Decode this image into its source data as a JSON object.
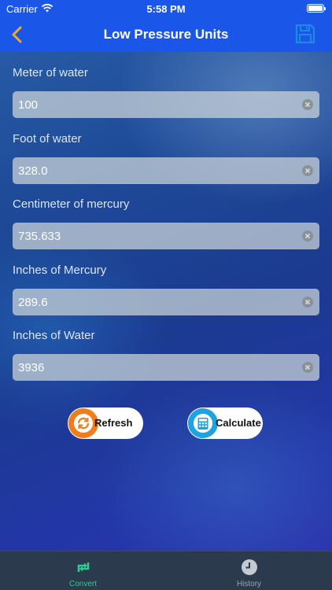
{
  "status_bar": {
    "carrier": "Carrier",
    "time": "5:58 PM"
  },
  "nav": {
    "title": "Low Pressure Units",
    "back_icon": "chevron-left-icon",
    "save_icon": "floppy-disk-icon"
  },
  "fields": [
    {
      "label": "Meter of water",
      "value": "100"
    },
    {
      "label": "Foot of water",
      "value": "328.0"
    },
    {
      "label": "Centimeter of mercury",
      "value": "735.633"
    },
    {
      "label": "Inches of Mercury",
      "value": "289.6"
    },
    {
      "label": "Inches of Water",
      "value": "3936"
    }
  ],
  "buttons": {
    "refresh": {
      "label": "Refresh",
      "color": "#f07c1c"
    },
    "calculate": {
      "label": "Calculate",
      "color": "#1fa3e0"
    }
  },
  "tabs": [
    {
      "label": "Convert",
      "icon": "convert-arrows-icon",
      "active": true
    },
    {
      "label": "History",
      "icon": "clock-icon",
      "active": false
    }
  ],
  "colors": {
    "accent": "#1a56e8",
    "active_tab": "#2ecc8f",
    "inactive_tab": "#9aa4b0",
    "nav_icon": "#f0a92a"
  }
}
